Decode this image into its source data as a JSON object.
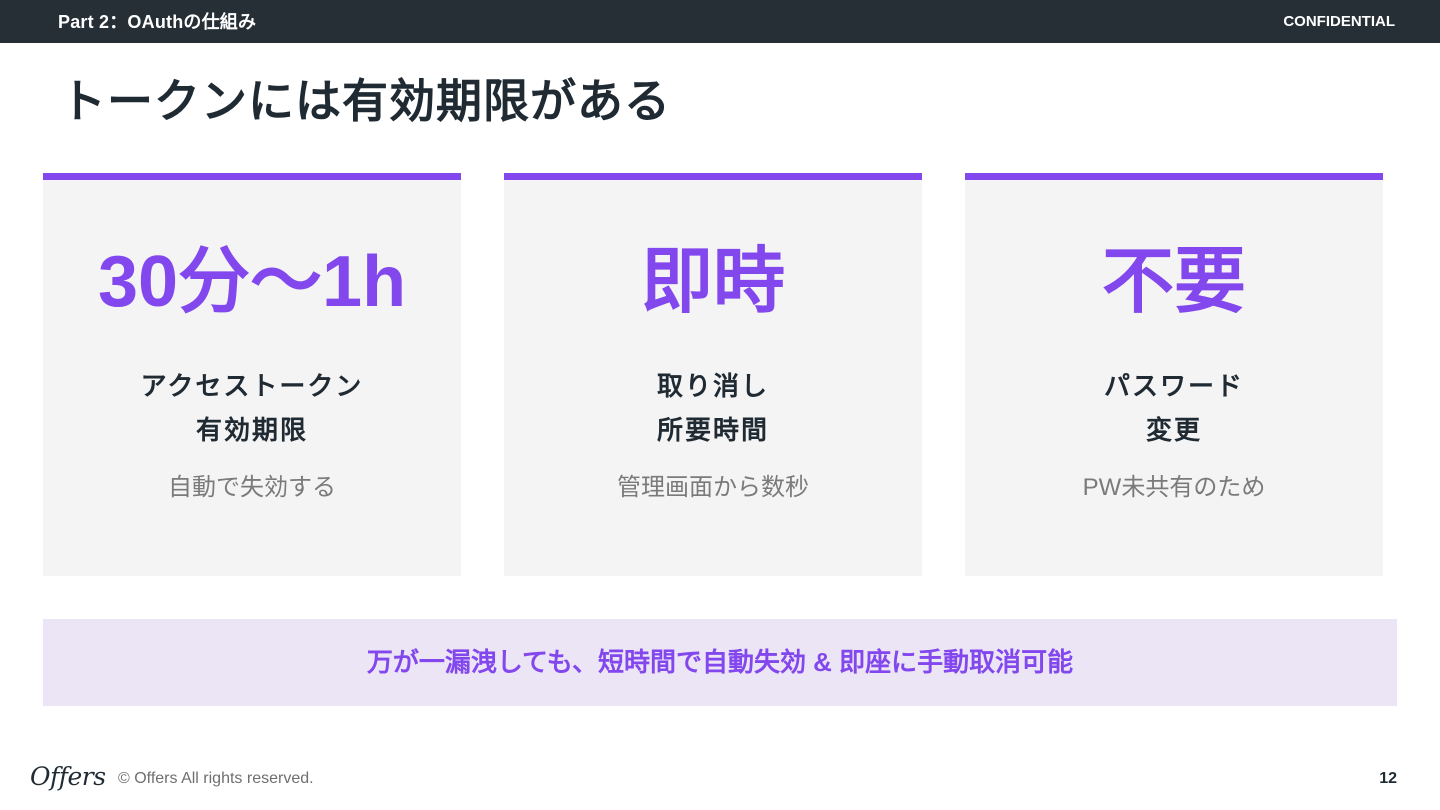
{
  "header": {
    "section": "Part 2：OAuthの仕組み",
    "badge": "CONFIDENTIAL"
  },
  "title": "トークンには有効期限がある",
  "cards": [
    {
      "value": "30分～1h",
      "label_line1": "アクセストークン",
      "label_line2": "有効期限",
      "note": "自動で失効する"
    },
    {
      "value": "即時",
      "label_line1": "取り消し",
      "label_line2": "所要時間",
      "note": "管理画面から数秒"
    },
    {
      "value": "不要",
      "label_line1": "パスワード",
      "label_line2": "変更",
      "note": "PW未共有のため"
    }
  ],
  "banner": "万が一漏洩しても、短時間で自動失効 & 即座に手動取消可能",
  "footer": {
    "logo": "Offers",
    "copyright": "© Offers All rights reserved.",
    "page_number": "12"
  },
  "colors": {
    "accent": "#8348ed",
    "header_bg": "#262f36",
    "card_bg": "#f4f4f5",
    "banner_bg": "#ece5f5"
  }
}
